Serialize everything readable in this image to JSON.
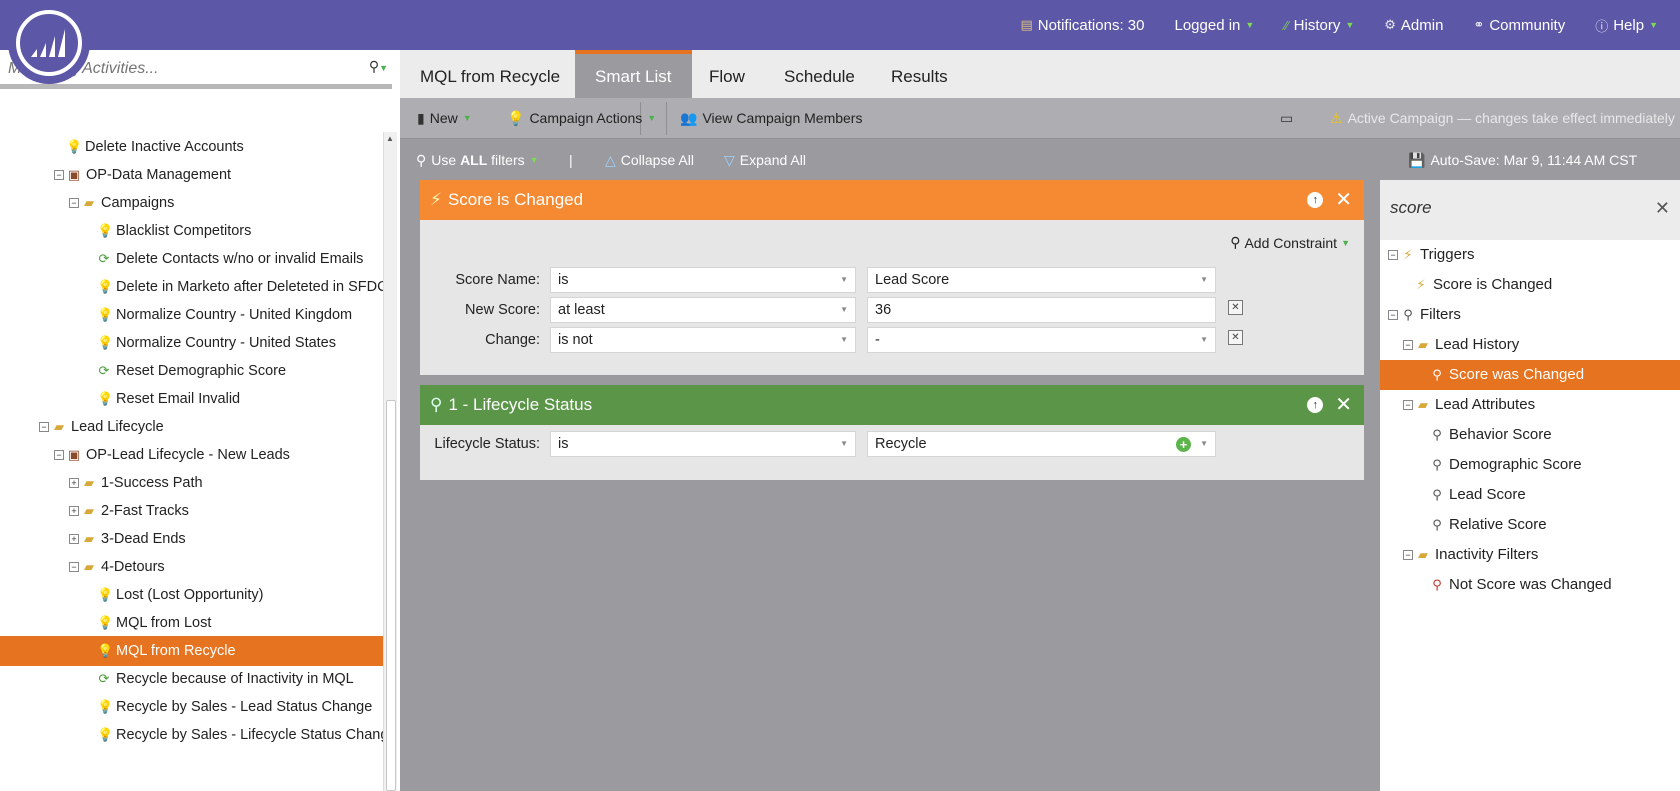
{
  "topnav": {
    "notifications": "Notifications: 30",
    "logged_in": "Logged in",
    "history": "History",
    "admin": "Admin",
    "community": "Community",
    "help": "Help"
  },
  "left": {
    "search_placeholder": "Marketing Activities...",
    "tree": [
      {
        "label": "Delete Inactive Accounts"
      },
      {
        "label": "OP-Data Management"
      },
      {
        "label": "Campaigns"
      },
      {
        "label": "Blacklist Competitors"
      },
      {
        "label": "Delete Contacts w/no or invalid Emails"
      },
      {
        "label": "Delete in Marketo after Deleteted in SFDC"
      },
      {
        "label": "Normalize Country - United Kingdom"
      },
      {
        "label": "Normalize Country - United States"
      },
      {
        "label": "Reset Demographic Score"
      },
      {
        "label": "Reset Email Invalid"
      },
      {
        "label": "Lead Lifecycle"
      },
      {
        "label": "OP-Lead Lifecycle - New Leads"
      },
      {
        "label": "1-Success Path"
      },
      {
        "label": "2-Fast Tracks"
      },
      {
        "label": "3-Dead Ends"
      },
      {
        "label": "4-Detours"
      },
      {
        "label": "Lost (Lost Opportunity)"
      },
      {
        "label": "MQL from Lost"
      },
      {
        "label": "MQL from Recycle"
      },
      {
        "label": "Recycle because of Inactivity in MQL"
      },
      {
        "label": "Recycle by Sales - Lead Status Change"
      },
      {
        "label": "Recycle by Sales - Lifecycle Status Change"
      }
    ]
  },
  "tabs": [
    "MQL from Recycle",
    "Smart List",
    "Flow",
    "Schedule",
    "Results"
  ],
  "toolbar": {
    "new": "New",
    "campaign_actions": "Campaign Actions",
    "view_members": "View Campaign Members",
    "active_notice": "Active Campaign — changes take effect immediately"
  },
  "filterbar": {
    "use": "Use ",
    "all": "ALL",
    "filters": " filters",
    "pipe": "|",
    "collapse": "Collapse All",
    "expand": "Expand All",
    "autosave": "Auto-Save: Mar 9, 11:44 AM CST"
  },
  "trigger_card": {
    "title": "Score is Changed",
    "add_constraint": "Add Constraint",
    "rows": [
      {
        "label": "Score Name:",
        "op": "is",
        "value": "Lead Score"
      },
      {
        "label": "New Score:",
        "op": "at least",
        "value": "36"
      },
      {
        "label": "Change:",
        "op": "is not",
        "value": "-"
      }
    ]
  },
  "filter_card": {
    "title": "1 - Lifecycle Status",
    "rows": [
      {
        "label": "Lifecycle Status:",
        "op": "is",
        "value": "Recycle"
      }
    ]
  },
  "right": {
    "search_value": "score",
    "tree": [
      {
        "label": "Triggers"
      },
      {
        "label": "Score is Changed"
      },
      {
        "label": "Filters"
      },
      {
        "label": "Lead History"
      },
      {
        "label": "Score was Changed"
      },
      {
        "label": "Lead Attributes"
      },
      {
        "label": "Behavior Score"
      },
      {
        "label": "Demographic Score"
      },
      {
        "label": "Lead Score"
      },
      {
        "label": "Relative Score"
      },
      {
        "label": "Inactivity Filters"
      },
      {
        "label": "Not Score was Changed"
      }
    ]
  }
}
